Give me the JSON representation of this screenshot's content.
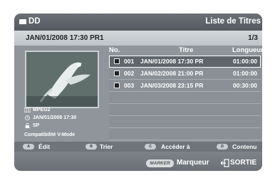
{
  "header": {
    "device": "DD",
    "screen_title": "Liste de Titres",
    "current_title": "JAN/01/2008 17:30 PR1",
    "page": "1/3"
  },
  "preview": {
    "codec": "MPEG2",
    "recorded": "JAN/01/2008 17:30",
    "quality": "SP",
    "compat": "Compatibilité V-Mode"
  },
  "list": {
    "columns": {
      "no": "No.",
      "title": "Titre",
      "length": "Longueur"
    },
    "items": [
      {
        "no": "001",
        "title": "JAN/01/2008 17:30 PR",
        "length": "01:00:00"
      },
      {
        "no": "002",
        "title": "JAN/02/2008 21:00 PR",
        "length": "01:00:00"
      },
      {
        "no": "003",
        "title": "JAN/03/2008 23:15 PR",
        "length": "00:30:00"
      }
    ]
  },
  "buttons": [
    {
      "key": "A",
      "label": "Édit"
    },
    {
      "key": "B",
      "label": "Trier"
    },
    {
      "key": "C",
      "label": "Accéder à"
    },
    {
      "key": "D",
      "label": "Contenu"
    }
  ],
  "footer": {
    "marker_key": "MARKER",
    "marker_label": "Marqueur",
    "exit_label": "SORTIE"
  },
  "colors": {
    "screen_bg": "#8f959a",
    "bar_dark": "#5a6065",
    "selected_row": "#5f666b"
  },
  "icons": [
    "disc-icon",
    "film-icon",
    "clock-icon",
    "lock-icon",
    "exit-icon"
  ]
}
